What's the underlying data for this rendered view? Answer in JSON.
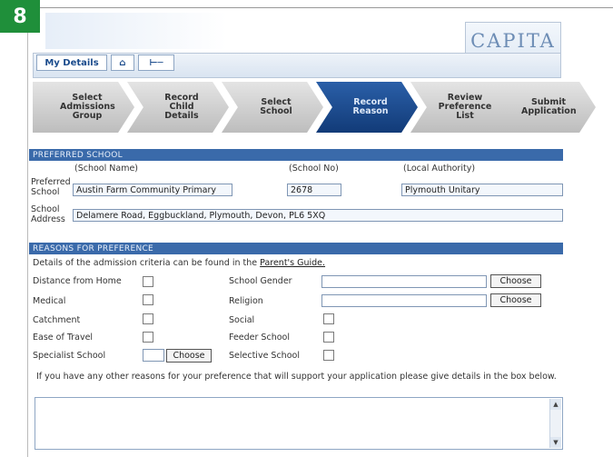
{
  "badge": "8",
  "logo": "CAPITA",
  "nav": {
    "my_details": "My Details",
    "home_icon": "⌂",
    "key_icon": "⊢─"
  },
  "steps": [
    {
      "label": "Select Admissions Group"
    },
    {
      "label": "Record Child Details"
    },
    {
      "label": "Select School"
    },
    {
      "label": "Record Reason"
    },
    {
      "label": "Review Preference List"
    },
    {
      "label": "Submit Application"
    }
  ],
  "active_step": "Record Reason",
  "preferred": {
    "heading": "PREFERRED SCHOOL",
    "col_name": "(School Name)",
    "col_no": "(School No)",
    "col_la": "(Local Authority)",
    "label_school": "Preferred School",
    "school_name": "Austin Farm Community Primary",
    "school_no": "2678",
    "local_authority": "Plymouth Unitary",
    "label_address": "School Address",
    "address": "Delamere Road, Eggbuckland, Plymouth, Devon, PL6 5XQ"
  },
  "reasons": {
    "heading": "REASONS FOR PREFERENCE",
    "intro": "Details of the admission criteria can be found in the",
    "guide_link": "Parent's Guide.",
    "distance": "Distance from Home",
    "medical": "Medical",
    "catchment": "Catchment",
    "ease": "Ease of Travel",
    "specialist": "Specialist School",
    "gender": "School Gender",
    "religion": "Religion",
    "social": "Social",
    "feeder": "Feeder School",
    "selective": "Selective School",
    "choose": "Choose",
    "other_text": "If you have any other reasons for your preference that will support your application please give details in the box below."
  },
  "colors": {
    "accent": "#3a6aaa",
    "active_step": "#1c4a8c",
    "badge": "#1f8f3a"
  }
}
